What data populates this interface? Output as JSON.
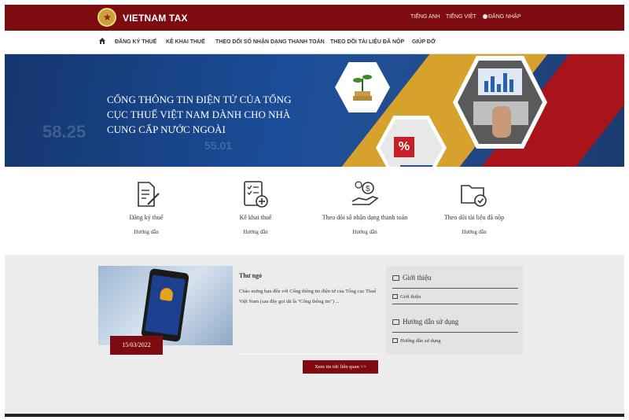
{
  "header": {
    "brand": "VIETNAM TAX",
    "links": [
      "TIẾNG ANH",
      "TIẾNG VIỆT"
    ],
    "login": "ĐĂNG NHẬP",
    "colors": {
      "primary": "#7d0b10"
    }
  },
  "nav": {
    "home_icon": "home-icon",
    "items": [
      "ĐĂNG KÝ THUẾ",
      "KÊ KHAI THUẾ",
      "THEO DÕI SỐ NHẬN DẠNG THANH TOÁN",
      "THEO DÕI TÀI LIỆU ĐÃ NỘP",
      "GIÚP ĐỠ"
    ]
  },
  "banner": {
    "title": "Cổng thông tin điện tử của Tổng cục Thuế Việt Nam dành cho nhà cung cấp nước ngoài",
    "numbers": [
      "58.25",
      "55.01"
    ]
  },
  "features": [
    {
      "label": "Đăng ký thuế",
      "sub": "Hướng dẫn",
      "icon": "document-pen-icon"
    },
    {
      "label": "Kê khai thuế",
      "sub": "Hướng dẫn",
      "icon": "checklist-add-icon"
    },
    {
      "label": "Theo dõi số nhận dạng thanh toán",
      "sub": "Hướng dẫn",
      "icon": "money-hand-icon"
    },
    {
      "label": "Theo dõi tài liệu đã nộp",
      "sub": "Hướng dẫn",
      "icon": "folder-check-icon"
    }
  ],
  "news": {
    "date": "15/03/2022",
    "title": "Thư ngỏ",
    "desc": "Chào mừng bạn đến với Cổng thông tin điện tử của Tổng cục Thuế Việt Nam (sau đây gọi tắt là \"Cổng thông tin\") ...",
    "more": "Xem tin tức liên quan >>"
  },
  "sidebar": {
    "sections": [
      {
        "heading": "Giới thiệu",
        "item": "Giới thiệu"
      },
      {
        "heading": "Hướng dẫn sử dụng",
        "item": "Hướng dẫn sử dụng"
      }
    ]
  }
}
